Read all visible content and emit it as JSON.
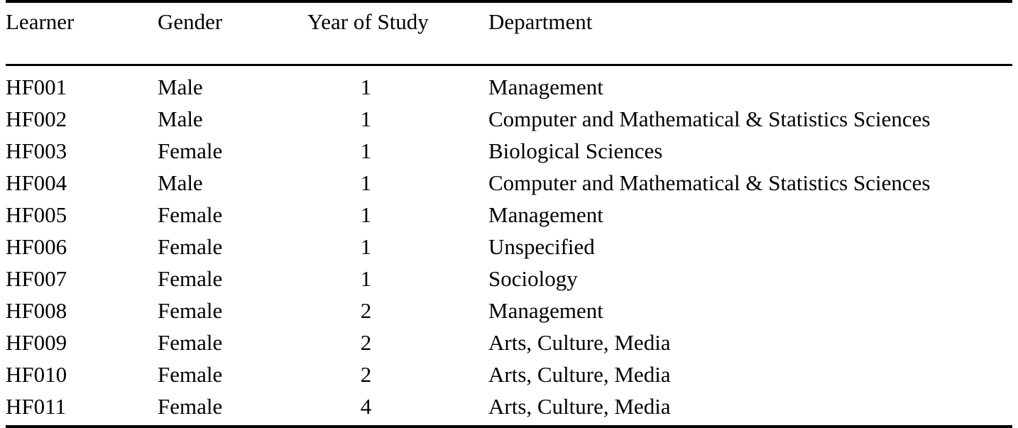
{
  "table": {
    "columns": [
      {
        "key": "learner",
        "label": "Learner"
      },
      {
        "key": "gender",
        "label": "Gender"
      },
      {
        "key": "year",
        "label": "Year of Study"
      },
      {
        "key": "department",
        "label": "Department"
      }
    ],
    "rows": [
      {
        "learner": "HF001",
        "gender": "Male",
        "year": "1",
        "department": "Management"
      },
      {
        "learner": "HF002",
        "gender": "Male",
        "year": "1",
        "department": "Computer and Mathematical & Statistics Sciences"
      },
      {
        "learner": "HF003",
        "gender": "Female",
        "year": "1",
        "department": "Biological Sciences"
      },
      {
        "learner": "HF004",
        "gender": "Male",
        "year": "1",
        "department": "Computer and Mathematical & Statistics Sciences"
      },
      {
        "learner": "HF005",
        "gender": "Female",
        "year": "1",
        "department": "Management"
      },
      {
        "learner": "HF006",
        "gender": "Female",
        "year": "1",
        "department": "Unspecified"
      },
      {
        "learner": "HF007",
        "gender": "Female",
        "year": "1",
        "department": "Sociology"
      },
      {
        "learner": "HF008",
        "gender": "Female",
        "year": "2",
        "department": "Management"
      },
      {
        "learner": "HF009",
        "gender": "Female",
        "year": "2",
        "department": "Arts, Culture, Media"
      },
      {
        "learner": "HF010",
        "gender": "Female",
        "year": "2",
        "department": "Arts, Culture, Media"
      },
      {
        "learner": "HF011",
        "gender": "Female",
        "year": "4",
        "department": "Arts, Culture, Media"
      }
    ]
  }
}
